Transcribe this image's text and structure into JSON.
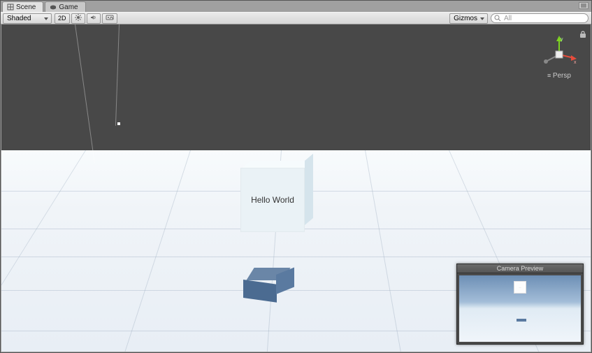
{
  "tabs": {
    "scene": "Scene",
    "game": "Game"
  },
  "toolbar": {
    "shading_mode": "Shaded",
    "btn_2d": "2D",
    "gizmos_label": "Gizmos",
    "search_placeholder": "All"
  },
  "scene": {
    "cube_text": "Hello World",
    "gizmo_persp": "Persp",
    "axis_x": "x",
    "axis_y": "y"
  },
  "camera_preview": {
    "title": "Camera Preview"
  },
  "icons": {
    "scene_tab": "scene-icon",
    "game_tab": "game-icon",
    "light": "light-icon",
    "audio": "audio-icon",
    "fx": "fx-icon",
    "search": "search-icon",
    "lock": "lock-icon"
  }
}
